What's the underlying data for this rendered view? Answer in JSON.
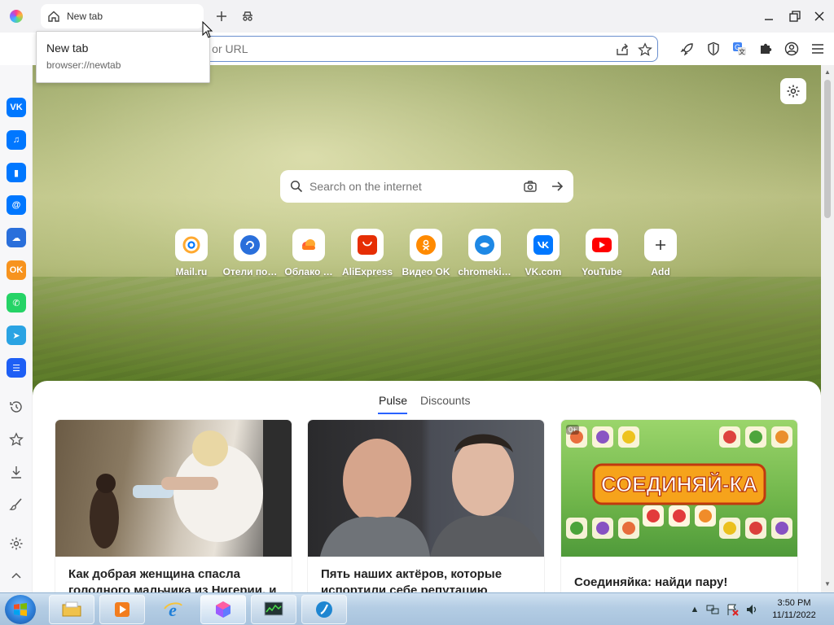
{
  "tab": {
    "title": "New tab"
  },
  "tooltip": {
    "title": "New tab",
    "url": "browser://newtab"
  },
  "omnibox": {
    "placeholder": "Enter a search word or URL",
    "visible_text": "word or URL"
  },
  "search": {
    "placeholder": "Search on the internet"
  },
  "quick_links": [
    {
      "label": "Mail.ru",
      "color": "#ffa930",
      "icon": "at-sign-icon"
    },
    {
      "label": "Отели по…",
      "color": "#2a6fdb",
      "icon": "ostrovok-icon"
    },
    {
      "label": "Облако …",
      "color": "#ff7a1a",
      "icon": "cloud-icon"
    },
    {
      "label": "AliExpress",
      "color": "#e62e04",
      "icon": "aliexpress-icon"
    },
    {
      "label": "Видео OK",
      "color": "#ff8a00",
      "icon": "ok-icon"
    },
    {
      "label": "chromeki…",
      "color": "#1e88e5",
      "icon": "chromekit-icon"
    },
    {
      "label": "VK.com",
      "color": "#0077ff",
      "icon": "vk-icon"
    },
    {
      "label": "YouTube",
      "color": "#ff0000",
      "icon": "youtube-icon"
    },
    {
      "label": "Add",
      "color": "#333333",
      "icon": "plus-icon"
    }
  ],
  "feed": {
    "tabs": [
      "Pulse",
      "Discounts"
    ],
    "active_tab": "Pulse",
    "cards": [
      {
        "title": "Как добрая женщина спасла голодного мальчика из Нигерии, и"
      },
      {
        "title": "Пять наших актёров, которые испортили себе репутацию"
      },
      {
        "title": "Соединяйка: найди пару!",
        "badge": "0+",
        "game_title": "СОЕДИНЯЙ-КА"
      }
    ]
  },
  "sidebar": {
    "apps": [
      {
        "name": "vk",
        "color": "#0077ff",
        "glyph": "VK"
      },
      {
        "name": "music",
        "color": "#0077ff",
        "glyph": "♫"
      },
      {
        "name": "stats",
        "color": "#0077ff",
        "glyph": "▮"
      },
      {
        "name": "mail",
        "color": "#0077ff",
        "glyph": "@"
      },
      {
        "name": "cloud",
        "color": "#2a6fdb",
        "glyph": "☁"
      },
      {
        "name": "ok",
        "color": "#f7931e",
        "glyph": "OK"
      },
      {
        "name": "whatsapp",
        "color": "#25d366",
        "glyph": "✆"
      },
      {
        "name": "telegram",
        "color": "#2aa3e3",
        "glyph": "➤"
      },
      {
        "name": "tasks",
        "color": "#1e5ff5",
        "glyph": "☰"
      }
    ]
  },
  "taskbar": {
    "time": "3:50 PM",
    "date": "11/11/2022"
  },
  "colors": {
    "accent": "#2962ff",
    "omnibox_border": "#6a8fce"
  }
}
